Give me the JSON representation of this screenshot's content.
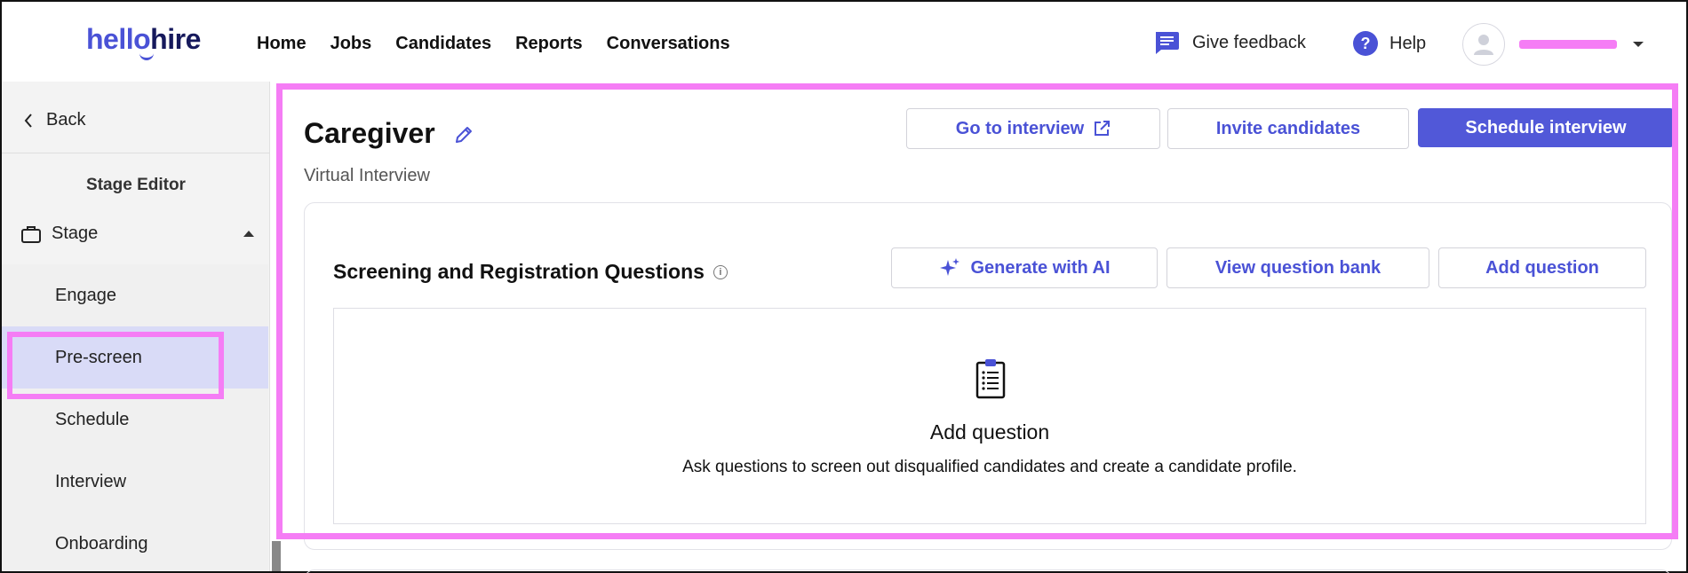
{
  "header": {
    "logo_part1": "hello",
    "logo_part2": "hire",
    "nav": [
      "Home",
      "Jobs",
      "Candidates",
      "Reports",
      "Conversations"
    ],
    "feedback_label": "Give feedback",
    "help_label": "Help"
  },
  "sidebar": {
    "back_label": "Back",
    "section_title": "Stage Editor",
    "stage_label": "Stage",
    "items": [
      {
        "label": "Engage"
      },
      {
        "label": "Pre-screen"
      },
      {
        "label": "Schedule"
      },
      {
        "label": "Interview"
      },
      {
        "label": "Onboarding"
      }
    ],
    "active_item": "Pre-screen"
  },
  "main": {
    "title": "Caregiver",
    "subtitle": "Virtual Interview",
    "actions": {
      "go_to_interview": "Go to interview",
      "invite_candidates": "Invite candidates",
      "schedule_interview": "Schedule interview"
    },
    "section": {
      "title": "Screening and Registration Questions",
      "info_glyph": "i",
      "generate_ai": "Generate with AI",
      "view_bank": "View question bank",
      "add_question": "Add question",
      "empty_title": "Add question",
      "empty_desc": "Ask questions to screen out disqualified candidates and create a candidate profile."
    }
  },
  "colors": {
    "brand": "#4a52d6",
    "brand_dark": "#16195c",
    "primary_button": "#5158d8",
    "highlight": "#f57df5",
    "active_item": "#d9dbf7"
  },
  "icons": {
    "feedback": "chat-bubble-icon",
    "help": "question-circle-icon",
    "edit": "pencil-icon",
    "external": "external-link-icon",
    "ai": "sparkle-icon",
    "empty": "clipboard-list-icon"
  }
}
